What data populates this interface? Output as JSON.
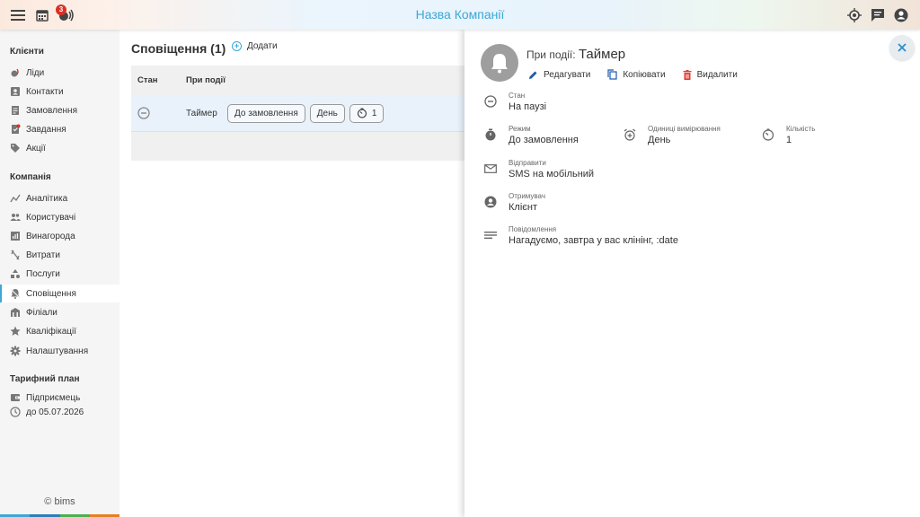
{
  "topbar": {
    "title": "Назва Компанії",
    "notification_count": "3"
  },
  "sidebar": {
    "sections": {
      "clients": "Клієнти",
      "company": "Компанія",
      "plan": "Тарифний план"
    },
    "client_items": [
      {
        "label": "Ліди",
        "icon": "lead-icon"
      },
      {
        "label": "Контакти",
        "icon": "contact-icon"
      },
      {
        "label": "Замовлення",
        "icon": "order-icon"
      },
      {
        "label": "Завдання",
        "icon": "task-icon"
      },
      {
        "label": "Акції",
        "icon": "tag-icon"
      }
    ],
    "company_items": [
      {
        "label": "Аналітика",
        "icon": "analytics-icon"
      },
      {
        "label": "Користувачі",
        "icon": "users-icon"
      },
      {
        "label": "Винагорода",
        "icon": "reward-icon"
      },
      {
        "label": "Витрати",
        "icon": "expenses-icon"
      },
      {
        "label": "Послуги",
        "icon": "services-icon"
      },
      {
        "label": "Сповіщення",
        "icon": "notification-icon",
        "active": true
      },
      {
        "label": "Філіали",
        "icon": "branches-icon"
      },
      {
        "label": "Кваліфікації",
        "icon": "star-icon"
      },
      {
        "label": "Налаштування",
        "icon": "gear-icon"
      }
    ],
    "plan_name": "Підприємець",
    "plan_until": "до 05.07.2026",
    "copyright": "© bims",
    "stripe_colors": [
      "#3da7d6",
      "#2c7fb8",
      "#4caf50",
      "#e67e22"
    ]
  },
  "main": {
    "title": "Сповіщення (1)",
    "add_label": "Додати",
    "columns": [
      "Стан",
      "При події"
    ],
    "rows": [
      {
        "event": "Таймер",
        "chips": [
          "До замовлення",
          "День"
        ],
        "count": "1"
      }
    ]
  },
  "panel": {
    "event_prefix": "При події:",
    "event_name": "Таймер",
    "actions": {
      "edit": "Редагувати",
      "copy": "Копіювати",
      "delete": "Видалити"
    },
    "fields": {
      "state_label": "Стан",
      "state_value": "На паузі",
      "mode_label": "Режим",
      "mode_value": "До замовлення",
      "unit_label": "Одиниці вимірювання",
      "unit_value": "День",
      "qty_label": "Кількість",
      "qty_value": "1",
      "send_label": "Відправити",
      "send_value": "SMS на мобільний",
      "recipient_label": "Отримувач",
      "recipient_value": "Клієнт",
      "message_label": "Повідомлення",
      "message_value": "Нагадуємо, завтра у вас клінінг, :date"
    }
  },
  "colors": {
    "accent": "#3da7d6",
    "delete": "#e53935",
    "edit": "#1e5aa8"
  }
}
